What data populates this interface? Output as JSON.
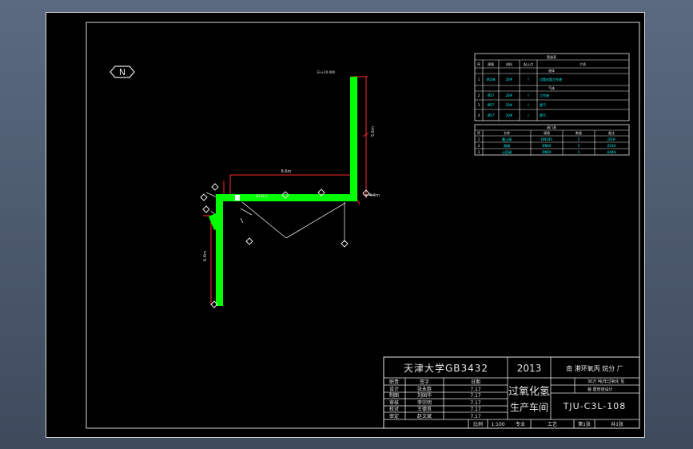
{
  "drawing": {
    "north_marker": "N",
    "dims": {
      "vertical_top": "5.6m",
      "horizontal_top": "8.6m",
      "elevation_right": "4.4m",
      "left_run": "6.4m",
      "top_label": "EL+10.000"
    }
  },
  "pipe_table": {
    "title": "管道表",
    "headers": [
      "序",
      "规格",
      "材料",
      "起止点",
      "介质"
    ],
    "section1": "液体",
    "section2": "气体",
    "rows": [
      [
        "1",
        "Ø108",
        "20#",
        "I",
        "过氧化氢工作液"
      ],
      [
        "2",
        "Ø57",
        "20#",
        "I",
        "工作液"
      ],
      [
        "3",
        "Ø57",
        "20#",
        "I",
        "氢气"
      ],
      [
        "4",
        "Ø57",
        "20#",
        "I",
        "氮气"
      ]
    ]
  },
  "valve_table": {
    "title": "阀门表",
    "headers": [
      "序",
      "名称",
      "规格",
      "数量",
      "备注"
    ],
    "rows": [
      [
        "1",
        "截止阀",
        "DN100",
        "2",
        "J41H"
      ],
      [
        "2",
        "闸阀",
        "DN50",
        "3",
        "Z41H"
      ],
      [
        "3",
        "止回阀",
        "DN50",
        "1",
        "H44H"
      ]
    ]
  },
  "title_block": {
    "university": "天津大学GB3432",
    "year": "2013",
    "project": "南 港环氧丙 烷分 厂",
    "sub1": "30万 吨/年过氧化 氢",
    "sub2": "装 置管道设计",
    "name_line1": "过氧化氢",
    "name_line2": "生产车间",
    "drawing_no": "TJU-C3L-108",
    "sign_headers": [
      "职责",
      "签字",
      "日期"
    ],
    "sign_rows": [
      [
        "设计",
        "张永胜",
        "7.17"
      ],
      [
        "制图",
        "刘国华",
        "7.17"
      ],
      [
        "审核",
        "李宗明",
        "7.17"
      ],
      [
        "校对",
        "王德良",
        "7.17"
      ],
      [
        "审定",
        "赵文斌",
        "7.17"
      ]
    ],
    "bottom": [
      "比例",
      "1:100",
      "专业",
      "工艺",
      "第1张",
      "共1张"
    ]
  }
}
